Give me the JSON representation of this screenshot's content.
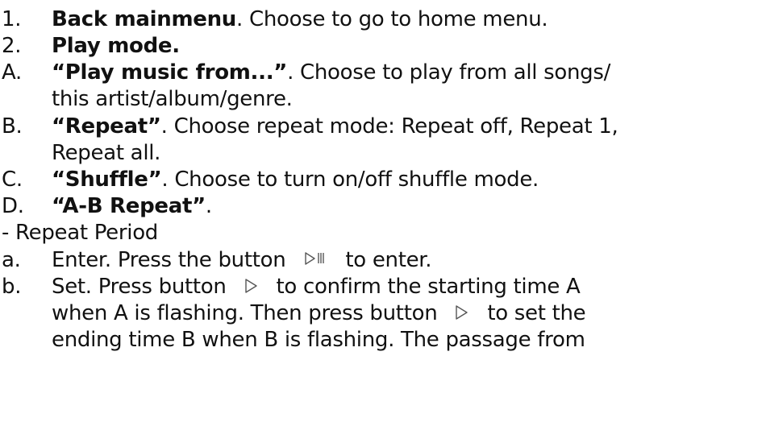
{
  "items": [
    {
      "marker": "1.",
      "bold": "Back mainmenu",
      "rest": ". Choose to go to home menu."
    },
    {
      "marker": "2.",
      "bold": "Play mode.",
      "rest": ""
    },
    {
      "marker": "A.",
      "bold": "“Play music from...”",
      "rest": ". Choose to play from all songs/"
    },
    {
      "cont": "this artist/album/genre."
    },
    {
      "marker": "B.",
      "bold": "“Repeat”",
      "rest": ". Choose repeat mode: Repeat off, Repeat 1,"
    },
    {
      "cont": "Repeat all."
    },
    {
      "marker": "C.",
      "bold": "“Shuffle”",
      "rest": ". Choose to turn on/off shuffle mode."
    },
    {
      "marker": "D.",
      "bold": "“A-B Repeat”",
      "rest": "."
    },
    {
      "plain": "- Repeat Period"
    },
    {
      "marker": "a.",
      "before": "Enter. Press the button",
      "after": "to enter."
    },
    {
      "marker": "b.",
      "before": "Set. Press button",
      "after": "to confirm the starting time A"
    },
    {
      "cont_before": "when A is flashing. Then press button",
      "cont_after": "to set the"
    },
    {
      "cont": "ending time B when B is flashing. The passage from"
    }
  ],
  "icons": {
    "play_pause": "play-pause-icon",
    "play": "play-icon"
  }
}
